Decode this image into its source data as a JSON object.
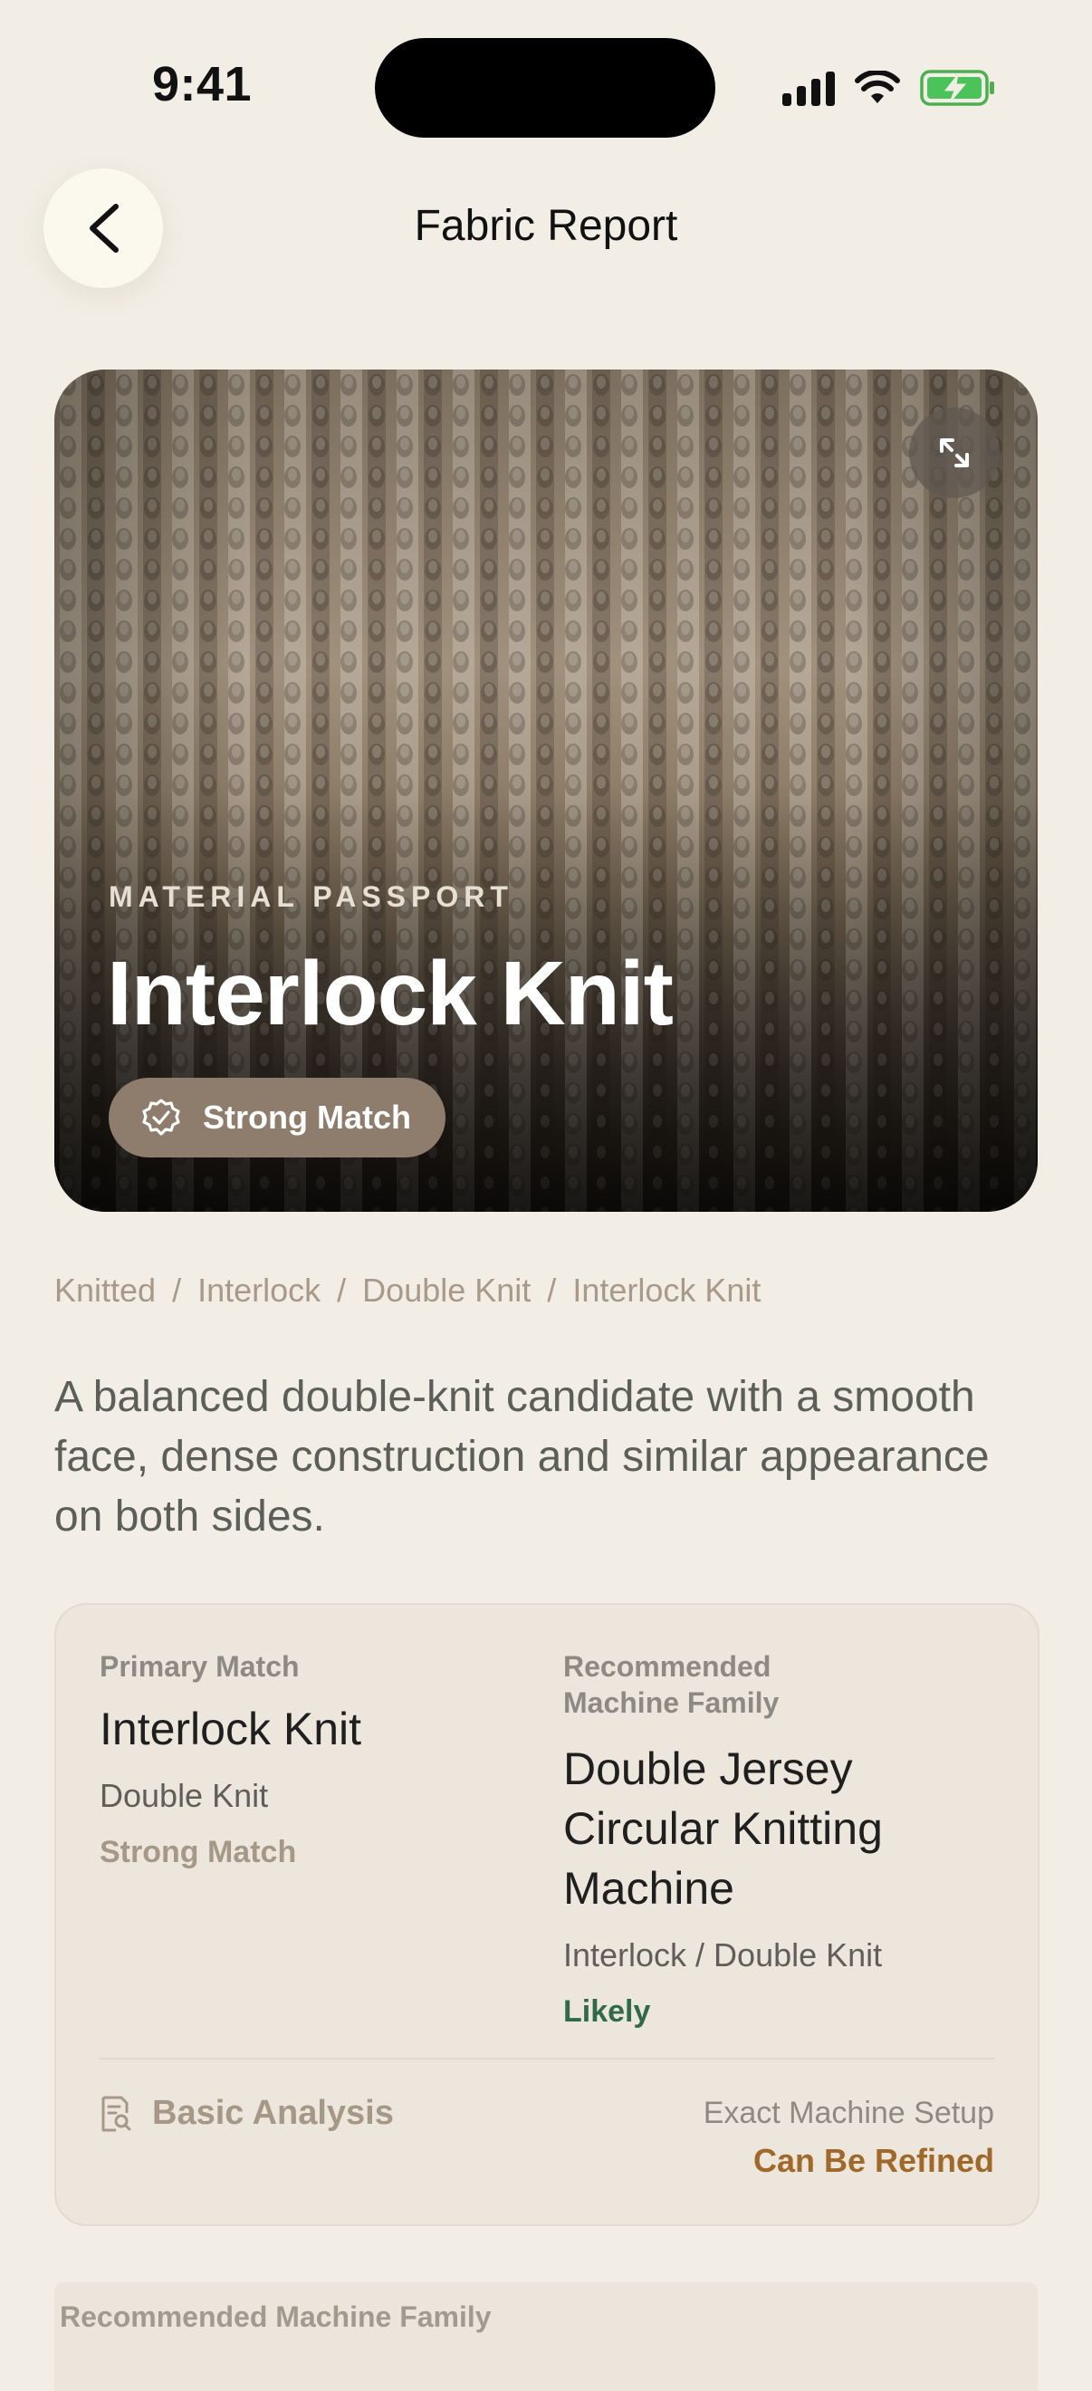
{
  "status_bar": {
    "time": "9:41"
  },
  "header": {
    "title": "Fabric Report"
  },
  "hero": {
    "overline": "MATERIAL PASSPORT",
    "title": "Interlock Knit",
    "badge": "Strong Match"
  },
  "breadcrumb": [
    "Knitted",
    "Interlock",
    "Double Knit",
    "Interlock Knit"
  ],
  "description": "A balanced double-knit candidate with a smooth face, dense construction and similar appearance on both sides.",
  "summary": {
    "primary": {
      "label": "Primary Match",
      "name": "Interlock Knit",
      "sub": "Double Knit",
      "confidence": "Strong Match"
    },
    "machine": {
      "label": "Recommended Machine Family",
      "name": "Double Jersey Circular Knitting Machine",
      "sub": "Interlock / Double Knit",
      "confidence": "Likely"
    },
    "footer": {
      "analysis": "Basic Analysis",
      "setup_label": "Exact Machine Setup",
      "setup_value": "Can Be Refined"
    }
  },
  "next_section": {
    "label": "Recommended Machine Family"
  },
  "colors": {
    "background": "#f2eee5",
    "accent_green": "#2f6b4a",
    "accent_amber": "#a0692a",
    "badge": "#8e7d6c"
  }
}
